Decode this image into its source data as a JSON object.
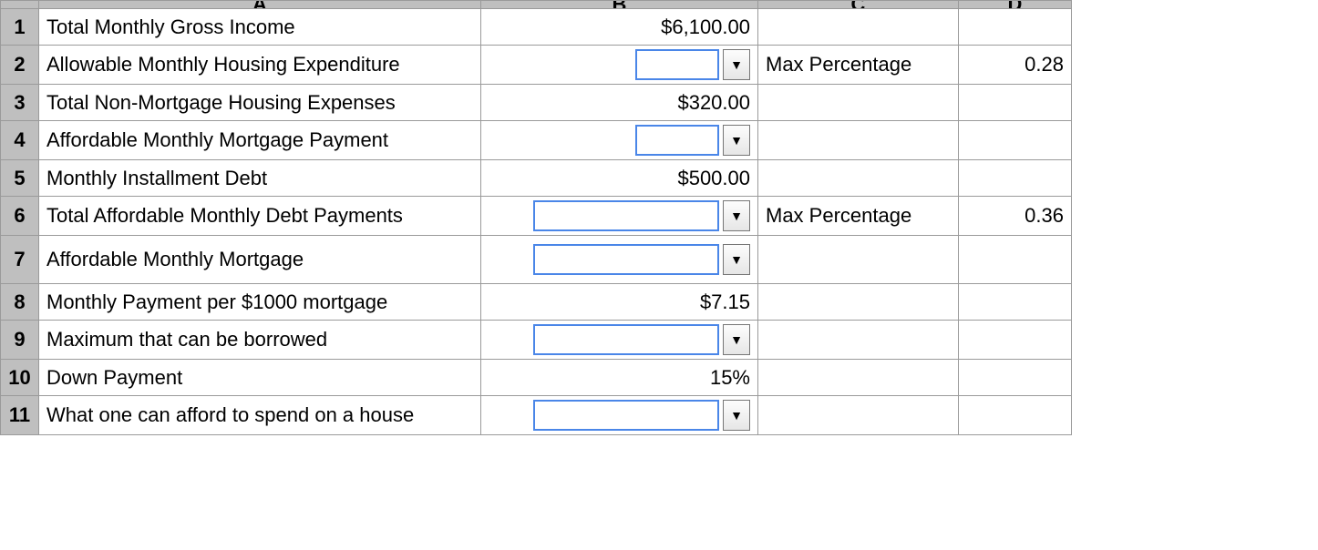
{
  "columns": {
    "A": "A",
    "B": "B",
    "C": "C",
    "D": "D"
  },
  "rows": [
    {
      "n": "1",
      "label": "Total Monthly Gross Income",
      "b_type": "text",
      "b_value": "$6,100.00",
      "c": "",
      "d": ""
    },
    {
      "n": "2",
      "label": "Allowable Monthly Housing Expenditure",
      "b_type": "dd",
      "b_style": "short",
      "c": "Max Percentage",
      "d": "0.28"
    },
    {
      "n": "3",
      "label": "Total Non-Mortgage Housing Expenses",
      "b_type": "text",
      "b_value": "$320.00",
      "c": "",
      "d": ""
    },
    {
      "n": "4",
      "label": "Affordable Monthly Mortgage Payment",
      "b_type": "dd",
      "b_style": "short",
      "c": "",
      "d": ""
    },
    {
      "n": "5",
      "label": "Monthly Installment Debt",
      "b_type": "text",
      "b_value": "$500.00",
      "c": "",
      "d": ""
    },
    {
      "n": "6",
      "label": "Total Affordable Monthly Debt Payments",
      "b_type": "dd",
      "b_style": "long",
      "c": "Max Percentage",
      "d": "0.36"
    },
    {
      "n": "7",
      "label": "Affordable Monthly Mortgage",
      "b_type": "dd",
      "b_style": "long",
      "c": "",
      "d": "",
      "tall": true
    },
    {
      "n": "8",
      "label": "Monthly Payment per $1000 mortgage",
      "b_type": "text",
      "b_value": "$7.15",
      "c": "",
      "d": ""
    },
    {
      "n": "9",
      "label": "Maximum that can be borrowed",
      "b_type": "dd",
      "b_style": "long",
      "c": "",
      "d": ""
    },
    {
      "n": "10",
      "label": "Down Payment",
      "b_type": "text",
      "b_value": "15%",
      "c": "",
      "d": ""
    },
    {
      "n": "11",
      "label": "What one can afford to spend on a house",
      "b_type": "dd",
      "b_style": "long",
      "c": "",
      "d": ""
    }
  ],
  "dropdown_glyph": "▼"
}
